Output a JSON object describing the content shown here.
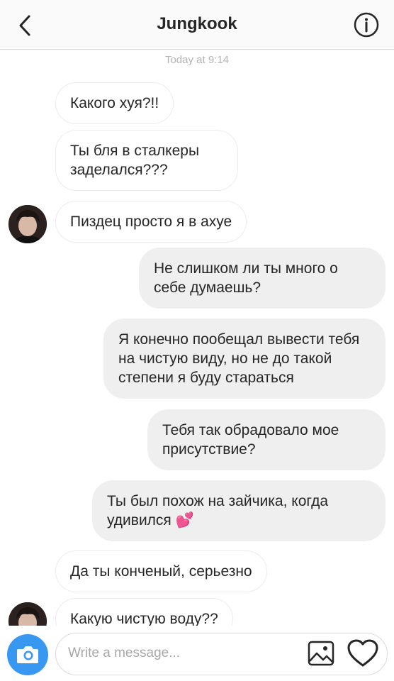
{
  "header": {
    "title": "Jungkook",
    "back_icon": "chevron-left-icon",
    "info_icon": "info-icon"
  },
  "thread": {
    "timestamp": "Today at 9:14",
    "messages": [
      {
        "direction": "incoming",
        "text": "Какого хуя?!!"
      },
      {
        "direction": "incoming",
        "text": "Ты бля в сталкеры заделался???"
      },
      {
        "direction": "incoming",
        "text": "Пиздец просто я в ахуе"
      },
      {
        "direction": "outgoing",
        "text": "Не слишком ли ты много о себе думаешь?"
      },
      {
        "direction": "outgoing",
        "text": "Я конечно пообещал вывести тебя на чистую виду, но не до такой степени я буду стараться"
      },
      {
        "direction": "outgoing",
        "text": "Тебя так обрадовало мое присутствие?"
      },
      {
        "direction": "outgoing",
        "text": "Ты был похож на зайчика, когда удивился 💕"
      },
      {
        "direction": "incoming",
        "text": "Да ты конченый, серьезно"
      },
      {
        "direction": "incoming",
        "text": "Какую чистую воду??"
      }
    ]
  },
  "composer": {
    "placeholder": "Write a message...",
    "camera_icon": "camera-icon",
    "gallery_icon": "image-icon",
    "like_icon": "heart-icon"
  },
  "colors": {
    "accent": "#3897f0",
    "incoming_bubble": "#ffffff",
    "outgoing_bubble": "#efefef",
    "header_bg": "#fafafa",
    "timestamp": "#b3b3b3"
  }
}
